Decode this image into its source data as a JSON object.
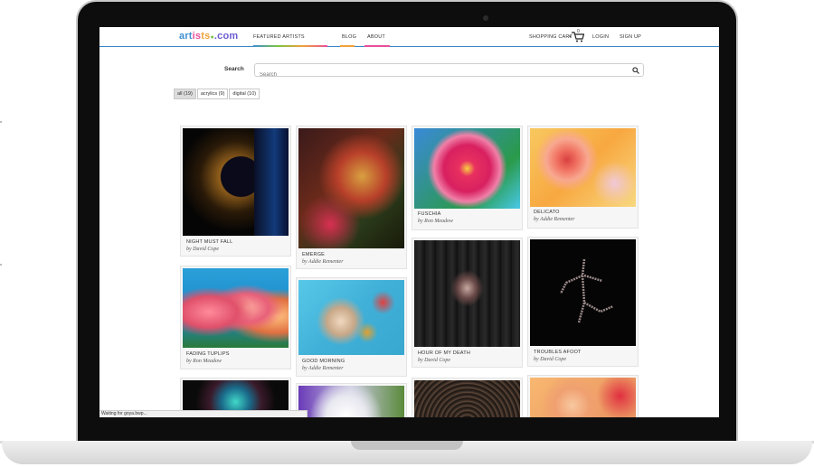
{
  "nav": {
    "logo_parts": [
      "art",
      "is",
      "ts",
      " ",
      ".com"
    ],
    "featured_artists": "FEATURED ARTISTS",
    "blog": "BLOG",
    "about": "ABOUT",
    "shopping_cart": "SHOPPING CART",
    "cart_count": "0",
    "login": "LOGIN",
    "sign_up": "SIGN UP"
  },
  "search": {
    "label": "Search",
    "placeholder": "Search"
  },
  "filters": [
    {
      "label": "all (19)",
      "active": true
    },
    {
      "label": "acrylics (9)",
      "active": false
    },
    {
      "label": "digital (10)",
      "active": false
    }
  ],
  "artworks": [
    {
      "title": "NIGHT MUST FALL",
      "artist": "by David Cope"
    },
    {
      "title": "EMERGE",
      "artist": "by Addie Rementer"
    },
    {
      "title": "FUSCHIA",
      "artist": "by Ron Meadow"
    },
    {
      "title": "DELICATO",
      "artist": "by Addie Rementer"
    },
    {
      "title": "FADING TUPLIPS",
      "artist": "by Ron Meadow"
    },
    {
      "title": "GOOD MORNING",
      "artist": "by Addie Rementer"
    },
    {
      "title": "HOUR OF MY DEATH",
      "artist": "by David Cope"
    },
    {
      "title": "TROUBLES AFOOT",
      "artist": "by David Cope"
    }
  ],
  "status_bar": "Waiting for goya.bwp...",
  "colors": {
    "nav_border": "#3a87c8",
    "blog_underline": "#f0a23a",
    "about_underline": "#e84f9b",
    "featured_underline": "#7cc243"
  }
}
